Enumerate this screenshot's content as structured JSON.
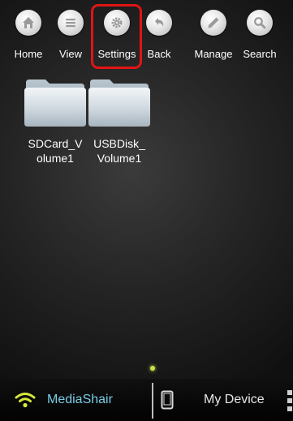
{
  "toolbar": {
    "items": [
      {
        "label": "Home",
        "icon": "home-icon"
      },
      {
        "label": "View",
        "icon": "list-icon"
      },
      {
        "label": "Settings",
        "icon": "gear-icon"
      },
      {
        "label": "Back",
        "icon": "back-arrow-icon"
      },
      {
        "label": "Manage",
        "icon": "pencil-icon"
      },
      {
        "label": "Search",
        "icon": "search-icon"
      }
    ],
    "highlighted": "Settings",
    "highlight_color": "#e21414"
  },
  "folders": [
    {
      "label": "SDCard_V\nolume1",
      "icon": "folder-icon"
    },
    {
      "label": "USBDisk_\nVolume1",
      "icon": "folder-icon"
    }
  ],
  "pager": {
    "active_page": 1,
    "dot_color": "#c8e04c"
  },
  "bottom_bar": {
    "media_tab": {
      "label": "MediaShair",
      "icon": "wifi-icon",
      "color": "#79cde6"
    },
    "device_tab": {
      "label": "My Device",
      "icon": "phone-icon"
    },
    "more_icon": "more-icon"
  }
}
